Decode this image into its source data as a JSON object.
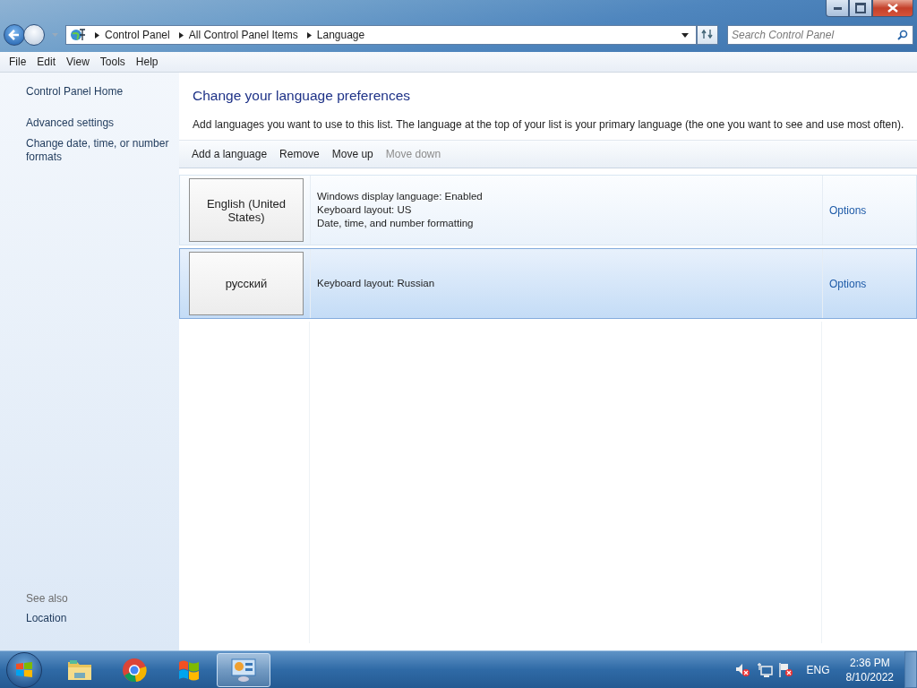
{
  "address_bar": {
    "breadcrumbs": [
      "Control Panel",
      "All Control Panel Items",
      "Language"
    ]
  },
  "search": {
    "placeholder": "Search Control Panel"
  },
  "menu": [
    "File",
    "Edit",
    "View",
    "Tools",
    "Help"
  ],
  "sidebar": {
    "links": [
      "Control Panel Home",
      "Advanced settings",
      "Change date, time, or number formats"
    ],
    "see_also": {
      "heading": "See also",
      "links": [
        "Location"
      ]
    }
  },
  "heading": "Change your language preferences",
  "description": "Add languages you want to use to this list. The language at the top of your list is your primary language (the one you want to see and use most often).",
  "toolbar": [
    {
      "label": "Add a language",
      "disabled": false
    },
    {
      "label": "Remove",
      "disabled": false
    },
    {
      "label": "Move up",
      "disabled": false
    },
    {
      "label": "Move down",
      "disabled": true
    }
  ],
  "languages": [
    {
      "name": "English (United States)",
      "details": [
        "Windows display language: Enabled",
        "Keyboard layout: US",
        "Date, time, and number formatting"
      ],
      "options": "Options",
      "selected": false
    },
    {
      "name": "русский",
      "details": [
        "Keyboard layout: Russian"
      ],
      "options": "Options",
      "selected": true
    }
  ],
  "taskbar": {
    "items": [
      {
        "kind": "folder",
        "selected": false
      },
      {
        "kind": "browser",
        "selected": false
      },
      {
        "kind": "flag",
        "selected": false
      },
      {
        "kind": "panel",
        "selected": true
      }
    ],
    "tray": {
      "language": "ENG",
      "time": "2:36 PM",
      "date": "8/10/2022"
    }
  }
}
